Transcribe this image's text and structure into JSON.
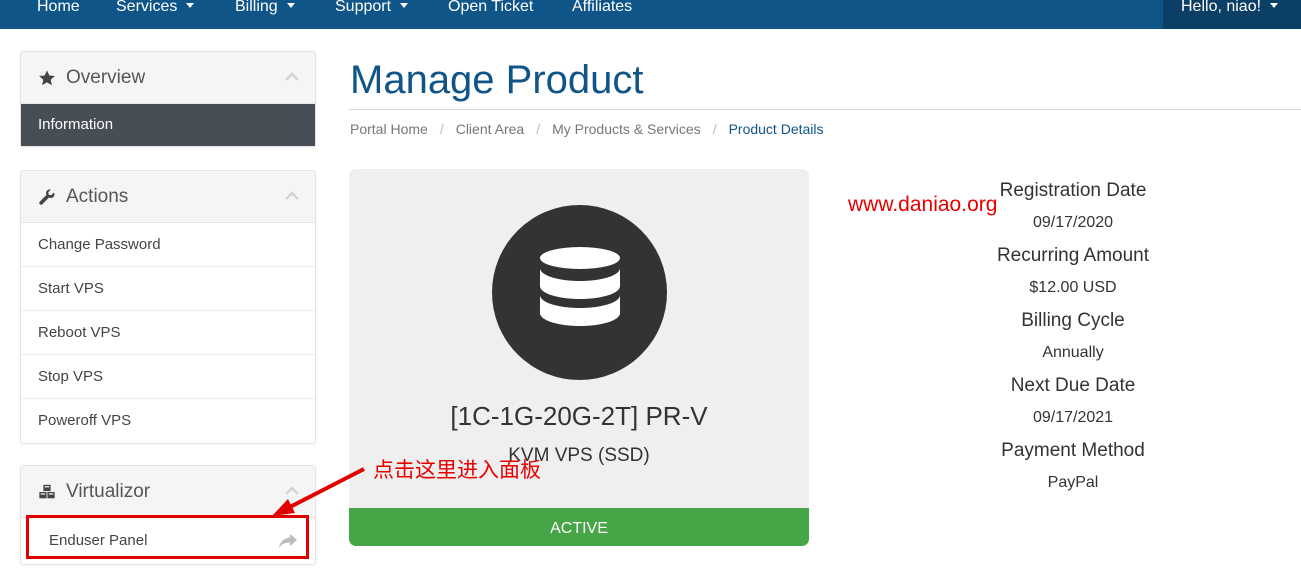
{
  "nav": {
    "home": "Home",
    "services": "Services",
    "billing": "Billing",
    "support": "Support",
    "open_ticket": "Open Ticket",
    "affiliates": "Affiliates",
    "user": "Hello, niao!"
  },
  "sidebar": {
    "overview": {
      "title": "Overview",
      "icon": "star-icon",
      "items": [
        {
          "label": "Information",
          "active": true
        }
      ]
    },
    "actions": {
      "title": "Actions",
      "icon": "wrench-icon",
      "items": [
        {
          "label": "Change Password"
        },
        {
          "label": "Start VPS"
        },
        {
          "label": "Reboot VPS"
        },
        {
          "label": "Stop VPS"
        },
        {
          "label": "Poweroff VPS"
        }
      ]
    },
    "virtualizor": {
      "title": "Virtualizor",
      "icon": "cubes-icon",
      "items": [
        {
          "label": "Enduser Panel",
          "icon": "share-icon"
        }
      ]
    }
  },
  "main": {
    "title": "Manage Product",
    "breadcrumb": [
      "Portal Home",
      "Client Area",
      "My Products & Services",
      "Product Details"
    ],
    "product": {
      "icon": "database-icon",
      "name": "[1C-1G-20G-2T] PR-V",
      "group": "KVM VPS (SSD)",
      "status": "ACTIVE"
    },
    "details": [
      {
        "label": "Registration Date",
        "value": "09/17/2020"
      },
      {
        "label": "Recurring Amount",
        "value": "$12.00 USD"
      },
      {
        "label": "Billing Cycle",
        "value": "Annually"
      },
      {
        "label": "Next Due Date",
        "value": "09/17/2021"
      },
      {
        "label": "Payment Method",
        "value": "PayPal"
      }
    ]
  },
  "overlay": {
    "watermark": "www.daniao.org",
    "annotation": "点击这里进入面板"
  },
  "colors": {
    "navbar": "#105588",
    "title": "#105588",
    "active_item": "#474e55",
    "status_active": "#46a546",
    "annotation_red": "#e80000"
  }
}
